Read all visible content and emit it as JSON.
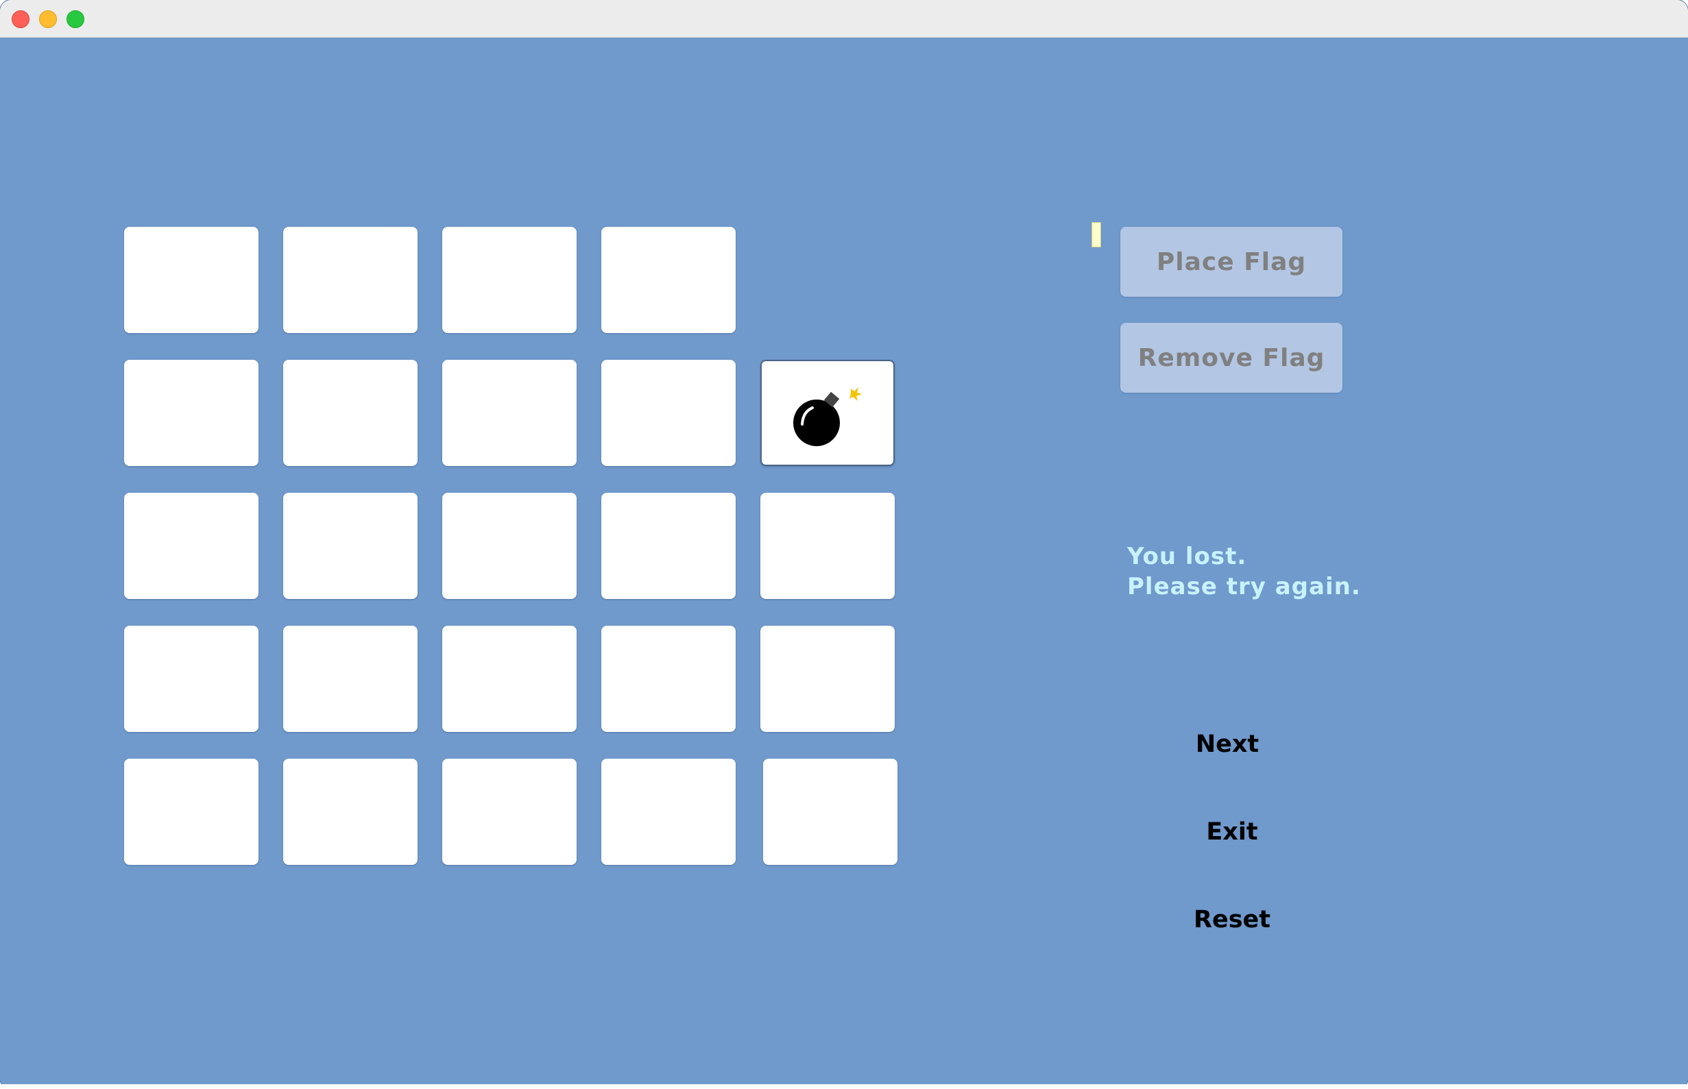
{
  "window": {
    "controls": [
      "close",
      "minimize",
      "maximize"
    ]
  },
  "board": {
    "rows": 5,
    "columns": 5,
    "cells": [
      [
        "hidden",
        "hidden",
        "hidden",
        "hidden",
        "empty"
      ],
      [
        "hidden",
        "hidden",
        "hidden",
        "hidden",
        "bomb"
      ],
      [
        "hidden",
        "hidden",
        "hidden",
        "hidden",
        "hidden"
      ],
      [
        "hidden",
        "hidden",
        "hidden",
        "hidden",
        "hidden"
      ],
      [
        "hidden",
        "hidden",
        "hidden",
        "hidden",
        "hidden"
      ]
    ],
    "revealed_icon": "bomb-icon"
  },
  "controls": {
    "place_flag": "Place Flag",
    "remove_flag": "Remove Flag"
  },
  "status": {
    "line1": "You lost.",
    "line2": "Please try again."
  },
  "actions": {
    "next": "Next",
    "exit": "Exit",
    "reset": "Reset"
  },
  "colors": {
    "background": "#7099cc",
    "cell": "#ffffff",
    "flag_button": "#b3c6e3",
    "flag_button_text": "#808080",
    "status_text": "#c8f2ff"
  }
}
